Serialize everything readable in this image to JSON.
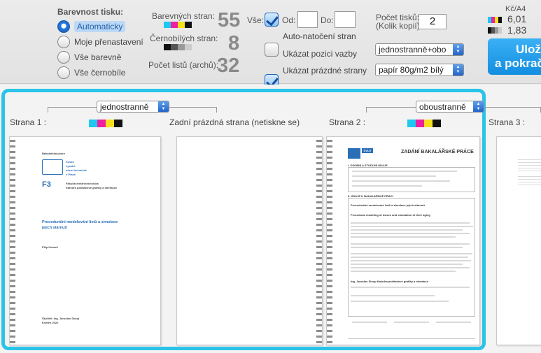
{
  "color_mode": {
    "title": "Barevnost tisku:",
    "options": [
      {
        "label": "Automaticky",
        "selected": true
      },
      {
        "label": "Moje přenastavení",
        "selected": false
      },
      {
        "label": "Vše barevně",
        "selected": false
      },
      {
        "label": "Vše černobíle",
        "selected": false
      }
    ]
  },
  "stats": {
    "color_pages_label": "Barevných stran:",
    "color_pages": "55",
    "bw_pages_label": "Černobílých stran:",
    "bw_pages": "8",
    "sheets_label": "Počet listů (archů):",
    "sheets": "32"
  },
  "range": {
    "all_label": "Vše:",
    "all_checked": true,
    "from_label": "Od:",
    "from_value": "",
    "to_label": "Do:",
    "to_value": ""
  },
  "checks": {
    "auto_rotate": "Auto-natočení stran",
    "auto_rotate_checked": false,
    "show_binding": "Ukázat pozici vazby",
    "show_binding_checked": true,
    "show_blank": "Ukázat prázdné strany",
    "show_blank_checked": true
  },
  "copies": {
    "label_line1": "Počet tisků:",
    "label_line2": "(Kolik kopií)",
    "value": "2"
  },
  "duplex_select": "jednostranně+obo",
  "paper_select": "papír 80g/m2 bílý",
  "prices": {
    "header": "Kč/A4",
    "color": "6,01",
    "bw": "1,83"
  },
  "submit_button": {
    "line1": "Uloži",
    "line2": "a pokrač"
  },
  "colors": {
    "accent": "#2bc4e8",
    "button": "#1a9bea",
    "cyan": "#1ec8f0",
    "magenta": "#ee1fa0",
    "yellow": "#f6e11a",
    "black": "#111111"
  },
  "preview": {
    "spread1_select": "jednostranně",
    "spread2_select": "oboustranně",
    "page1_label": "Strana 1 :",
    "blank_label": "Zadní prázdná strana (netiskne se)",
    "page2_label": "Strana 2 :",
    "page3_label": "Strana 3 :"
  },
  "page1": {
    "kind": "Bakalářská práce",
    "univ_line1": "České",
    "univ_line2": "vysoké",
    "univ_line3": "učení technické",
    "univ_line4": "v Praze",
    "badge": "F3",
    "faculty1": "Fakulta elektrotechnická",
    "faculty2": "Katedra počítačové grafiky a interakce",
    "title1": "Procedurální modelování listů a simulace",
    "title2": "jejich stárnutí",
    "author": "Filip Horaek",
    "supervisor": "Školitel: Ing. Jaroslav Sloup",
    "date": "Květen 2022"
  },
  "page2": {
    "logo_text": "ČVUT",
    "title": "ZADÁNÍ BAKALÁŘSKÉ PRÁCE",
    "section1": "I. OSOBNÍ A STUDIJNÍ ÚDAJE",
    "section2": "II. ÚDAJE K BAKALÁŘSKÉ PRÁCI",
    "thesis_cz": "Procedurální modelování listů a simulace jejich stárnutí",
    "thesis_en": "Procedural modeling of leaves and simulation of their aging",
    "supervisor": "Ing. Jaroslav Sloup   Katedra počítačové grafiky a interakce"
  }
}
